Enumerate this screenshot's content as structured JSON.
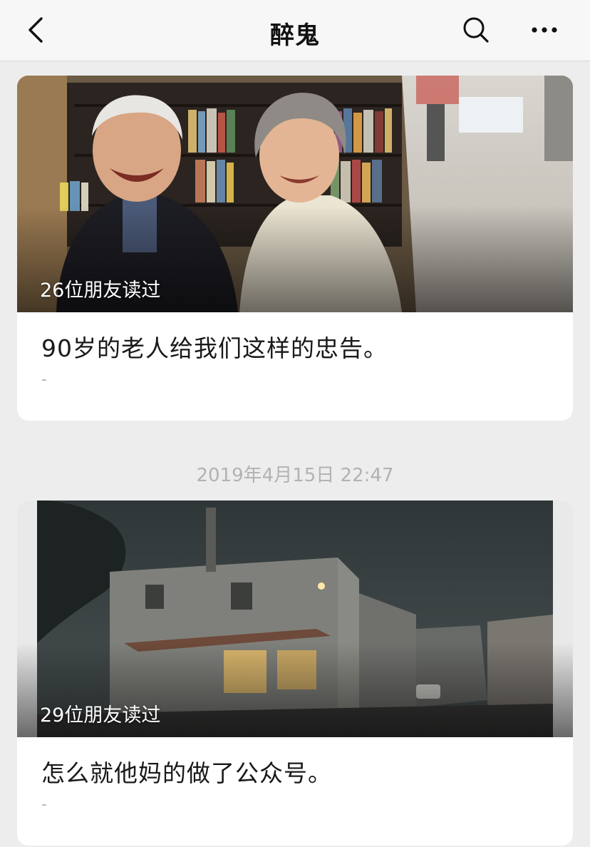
{
  "header": {
    "title": "醉鬼",
    "back_icon": "chevron-left-icon",
    "search_icon": "search-icon",
    "more_icon": "more-horizontal-icon"
  },
  "articles": [
    {
      "readers": "26位朋友读过",
      "title": "90岁的老人给我们这样的忠告。",
      "digest": "-"
    },
    {
      "readers": "29位朋友读过",
      "title": "怎么就他妈的做了公众号。",
      "digest": "-"
    }
  ],
  "timestamp": "2019年4月15日 22:47",
  "colors": {
    "background": "#ededed",
    "card": "#ffffff",
    "muted_text": "#b2b2b2"
  }
}
